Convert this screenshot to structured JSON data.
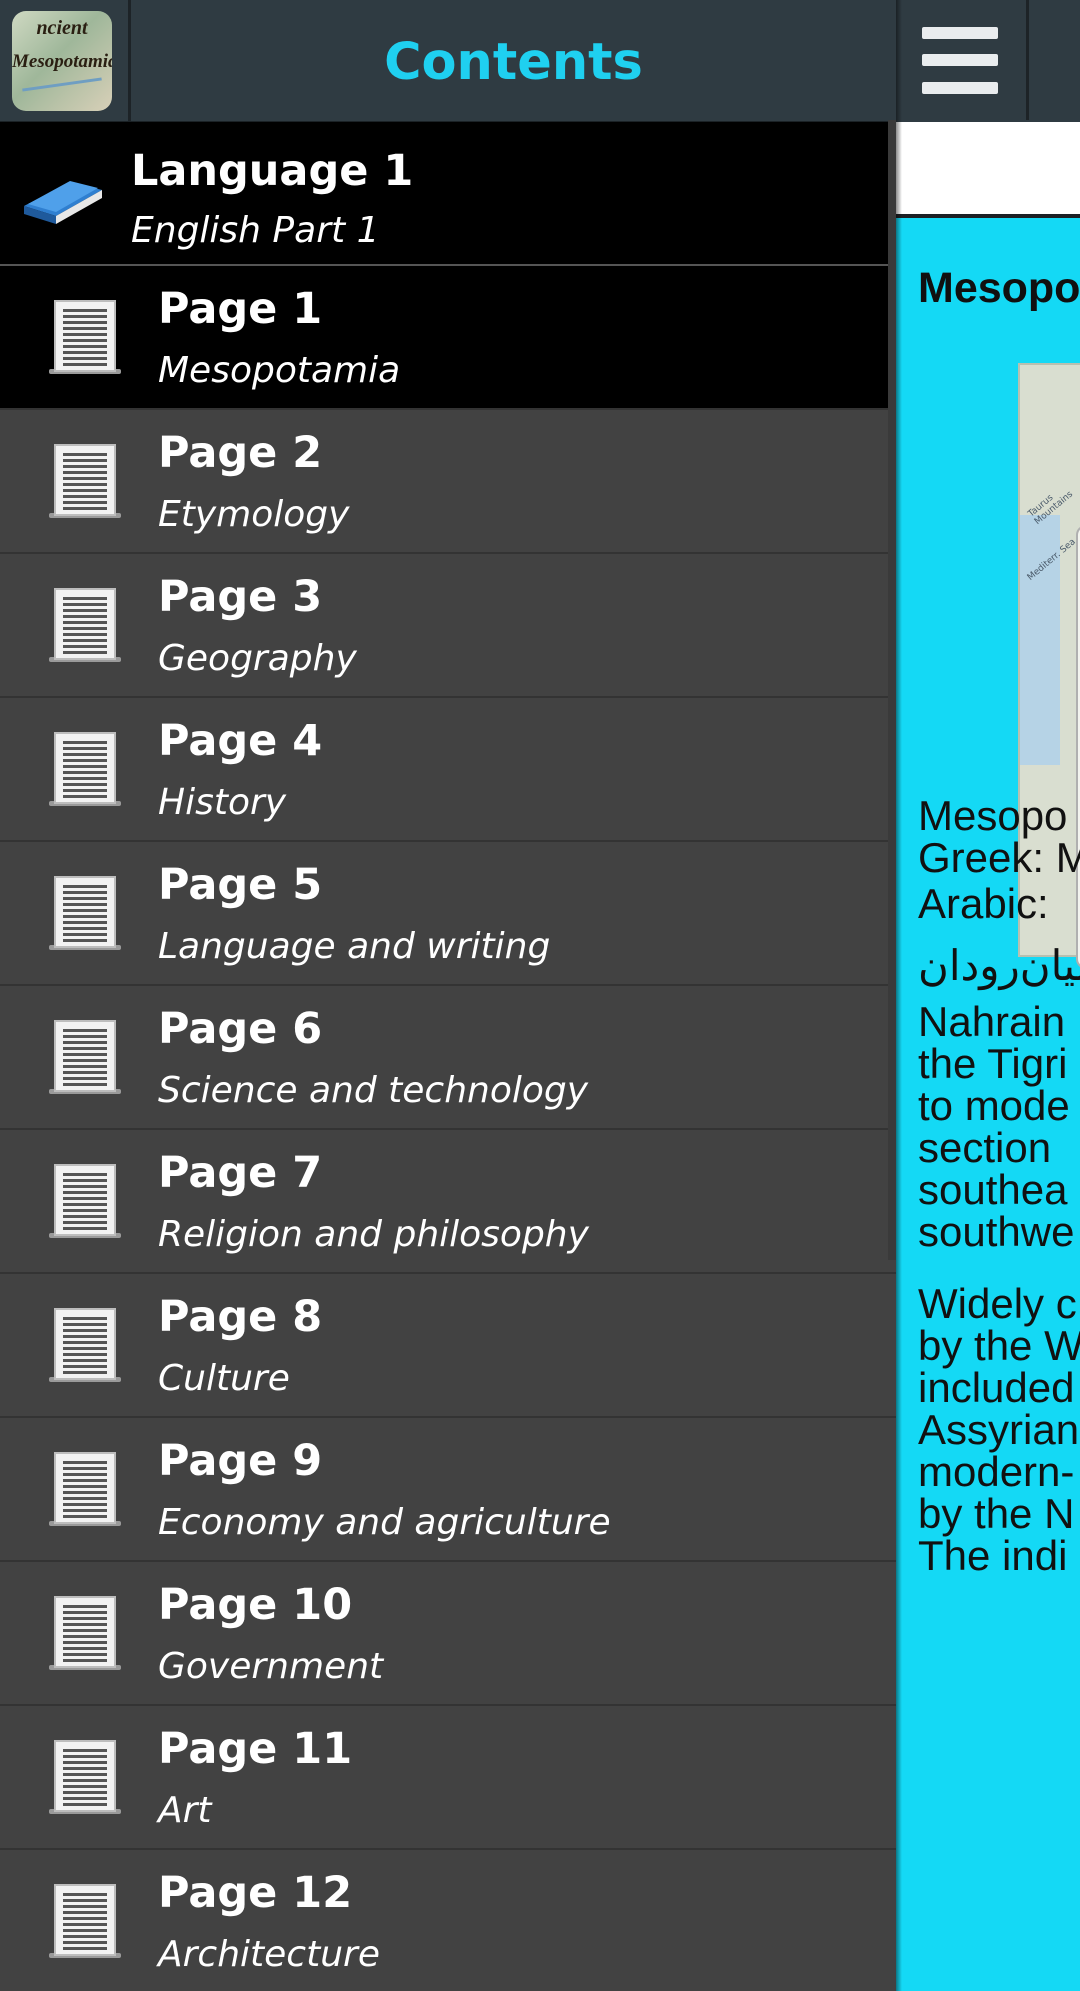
{
  "app": {
    "icon_text_line1": "ncient",
    "icon_text_line2": "Mesopotamia"
  },
  "drawer": {
    "title": "Contents",
    "section": {
      "title": "Language 1",
      "subtitle": "English Part 1"
    },
    "items": [
      {
        "title": "Page 1",
        "subtitle": "Mesopotamia",
        "selected": true
      },
      {
        "title": "Page 2",
        "subtitle": "Etymology"
      },
      {
        "title": "Page 3",
        "subtitle": "Geography"
      },
      {
        "title": "Page 4",
        "subtitle": "History"
      },
      {
        "title": "Page 5",
        "subtitle": "Language and writing"
      },
      {
        "title": "Page 6",
        "subtitle": "Science and technology"
      },
      {
        "title": "Page 7",
        "subtitle": "Religion and philosophy"
      },
      {
        "title": "Page 8",
        "subtitle": "Culture"
      },
      {
        "title": "Page 9",
        "subtitle": "Economy and agriculture"
      },
      {
        "title": "Page 10",
        "subtitle": "Government"
      },
      {
        "title": "Page 11",
        "subtitle": "Art"
      },
      {
        "title": "Page 12",
        "subtitle": "Architecture"
      }
    ]
  },
  "main": {
    "article_title": "Mesopo",
    "lines": [
      "Mesopo",
      "Greek: M",
      "Arabic: ",
      "میان‌رودان",
      "Nahrain",
      "the Tigri",
      "to mode",
      "section",
      "southea",
      "southwe",
      "Widely c",
      "by the W",
      "included",
      "Assyrian",
      "modern-",
      "by the N",
      "The indi"
    ]
  },
  "colors": {
    "accent": "#1fd0f0",
    "toolbar": "#2f3b42",
    "drawer_bg": "#424242",
    "selected_bg": "#000000",
    "article_bg": "#14d9f5"
  },
  "icons": {
    "menu": "hamburger-menu-icon",
    "section": "book-icon",
    "item": "page-document-icon"
  }
}
